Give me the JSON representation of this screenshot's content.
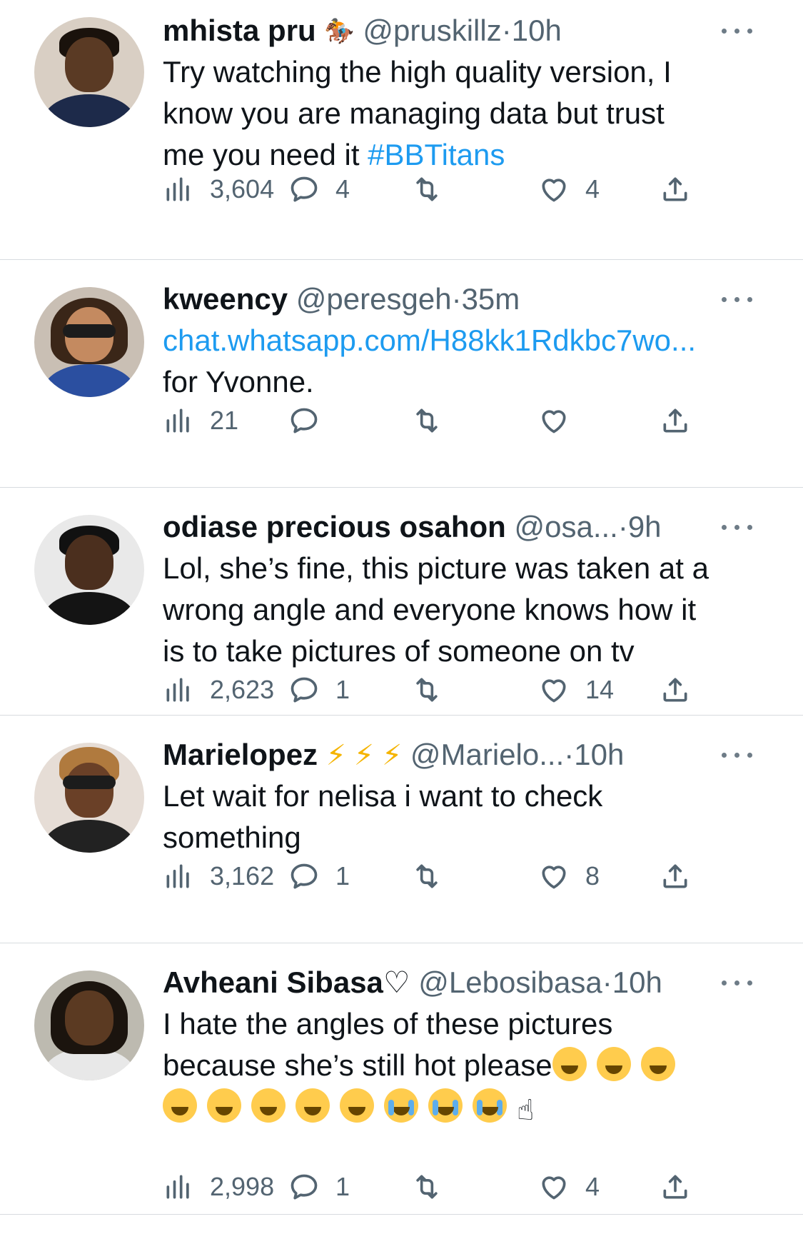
{
  "tweets": [
    {
      "name": "mhista pru",
      "badge": "🏇",
      "handle": "@pruskillz",
      "separator": "·",
      "time": "10h",
      "text_plain": "Try watching the high quality version, I\nknow you are managing data but trust\nme you need it ",
      "hashtag": "#BBTitans",
      "views": "3,604",
      "replies": "4",
      "retweets": "",
      "likes": "4"
    },
    {
      "name": "kweency",
      "handle": "@peresgeh",
      "separator": "·",
      "time": "35m",
      "link": "chat.whatsapp.com/H88kk1Rdkbc7wo...",
      "text_plain": "for Yvonne.",
      "views": "21",
      "replies": "",
      "retweets": "",
      "likes": ""
    },
    {
      "name": "odiase precious osahon",
      "handle": "@osa...",
      "separator": "·",
      "time": "9h",
      "text_plain": "Lol, she’s fine, this picture was taken at a\nwrong angle and everyone knows how it\nis to take pictures of someone on tv",
      "views": "2,623",
      "replies": "1",
      "retweets": "",
      "likes": "14"
    },
    {
      "name": "Marielopez",
      "badge": "⚡ ⚡ ⚡",
      "handle": "@Marielo...",
      "separator": "·",
      "time": "10h",
      "text_plain": "Let wait for nelisa i want to check\nsomething",
      "views": "3,162",
      "replies": "1",
      "retweets": "",
      "likes": "8"
    },
    {
      "name": "Avheani Sibasa",
      "badge": "♡",
      "handle": "@Lebosibasa",
      "separator": "·",
      "time": "10h",
      "text_plain": "I hate the angles of these pictures\nbecause she’s still hot please",
      "emoji_line": "☝",
      "views": "2,998",
      "replies": "1",
      "retweets": "",
      "likes": "4"
    }
  ],
  "icons": {
    "views": "bar-chart-icon",
    "reply": "speech-bubble-icon",
    "retweet": "retweet-icon",
    "like": "heart-icon",
    "share": "share-upload-icon",
    "more": "more-dots-icon"
  },
  "colors": {
    "text": "#0f1419",
    "secondary": "#536471",
    "link": "#1d9bf0",
    "divider": "#d7dbdf"
  }
}
